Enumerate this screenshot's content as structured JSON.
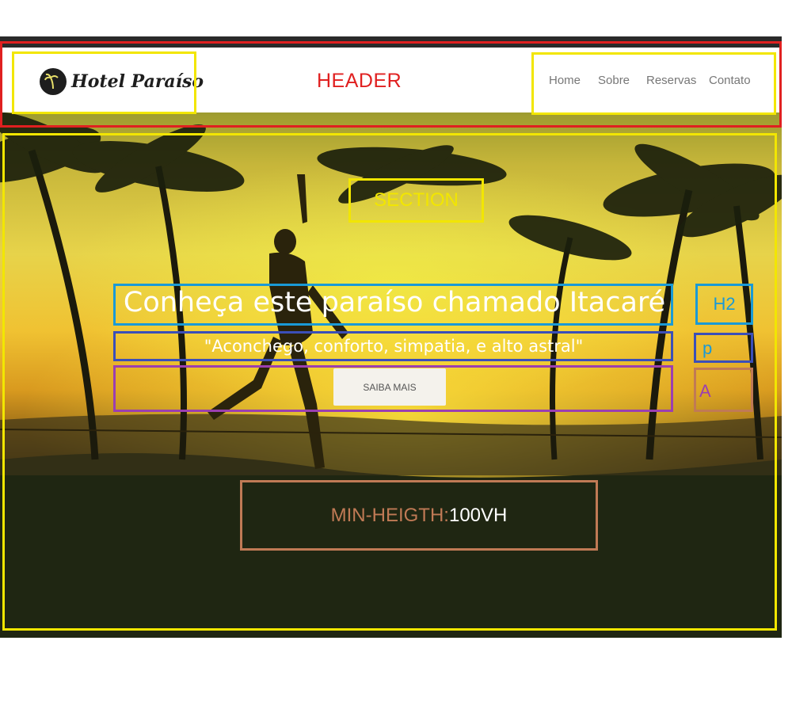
{
  "logo": {
    "text": "Hotel Paraíso"
  },
  "header": {
    "annotation": "HEADER"
  },
  "nav": {
    "items": [
      "Home",
      "Sobre",
      "Reservas",
      "Contato"
    ]
  },
  "annotations": {
    "section": "SECTION",
    "h2": "H2",
    "p": "p",
    "a": "A",
    "min_height_prefix": "MIN-HEIGTH:",
    "min_height_value": "100VH"
  },
  "hero": {
    "title": "Conheça este paraíso chamado Itacaré",
    "subtitle": "\"Aconchego, conforto, simpatia, e alto astral\"",
    "button": "SAIBA MAIS"
  },
  "colors": {
    "header_box": "#e02020",
    "section_box": "#f2e600",
    "h2_box": "#1a9ad6",
    "p_box": "#3b4fb8",
    "a_box_purple": "#9b3fb0",
    "a_label_box": "#c07a55"
  }
}
